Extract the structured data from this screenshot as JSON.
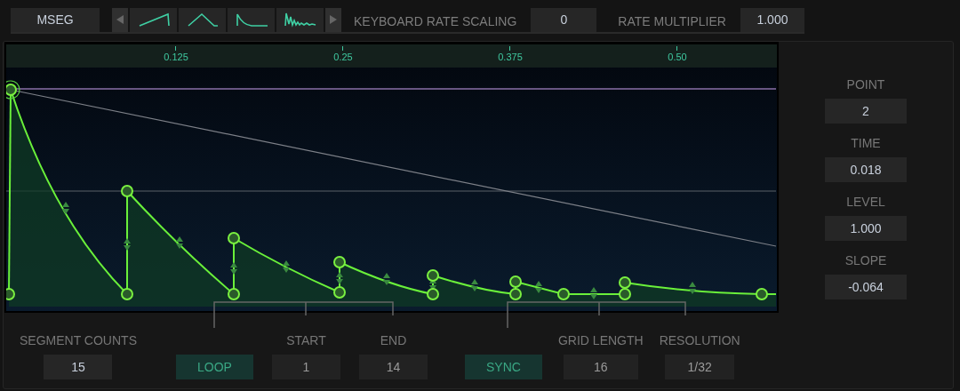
{
  "toolbar": {
    "mode_button": "MSEG",
    "keyboard_rate_scaling": {
      "label": "KEYBOARD RATE SCALING",
      "value": "0"
    },
    "rate_multiplier": {
      "label": "RATE MULTIPLIER",
      "value": "1.000"
    }
  },
  "ruler": {
    "ticks": [
      "0.125",
      "0.25",
      "0.375",
      "0.50"
    ]
  },
  "point_panel": {
    "fields": [
      {
        "label": "POINT",
        "value": "2"
      },
      {
        "label": "TIME",
        "value": "0.018"
      },
      {
        "label": "LEVEL",
        "value": "1.000"
      },
      {
        "label": "SLOPE",
        "value": "-0.064"
      }
    ]
  },
  "segment_counts": {
    "label": "SEGMENT COUNTS",
    "value": "15"
  },
  "loop": {
    "button": "LOOP",
    "on": true,
    "start": {
      "label": "START",
      "value": "1"
    },
    "end": {
      "label": "END",
      "value": "14"
    }
  },
  "sync": {
    "button": "SYNC",
    "on": true,
    "grid_length": {
      "label": "GRID LENGTH",
      "value": "16"
    },
    "resolution": {
      "label": "RESOLUTION",
      "value": "1/32"
    }
  }
}
